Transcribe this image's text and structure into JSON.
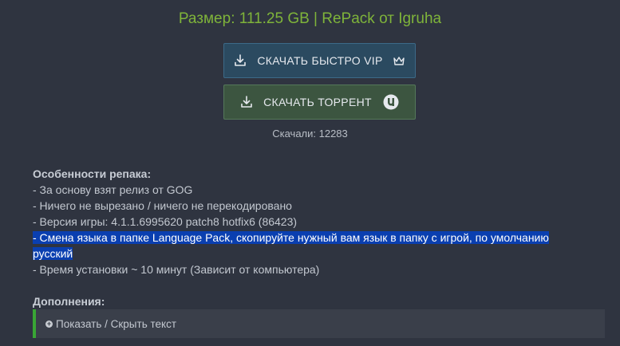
{
  "header": {
    "size_line": "Размер: 111.25 GB | RePack от Igruha"
  },
  "buttons": {
    "vip_label": "СКАЧАТЬ БЫСТРО VIP",
    "torrent_label": "СКАЧАТЬ ТОРРЕНТ"
  },
  "downloads": {
    "text": "Скачали: 12283"
  },
  "features": {
    "heading": "Особенности репака:",
    "items": [
      "- За основу взят релиз от GOG",
      "- Ничего не вырезано / ничего не перекодировано",
      "- Версия игры: 4.1.1.6995620 patch8 hotfix6 (86423)",
      "- Смена языка в папке Language Pack, скопируйте нужный вам язык в папку с игрой, по умолчанию русский",
      "- Время установки ~ 10 минут (Зависит от компьютера)"
    ]
  },
  "addons": {
    "heading": "Дополнения:",
    "spoiler_label": "Показать / Скрыть текст"
  },
  "colors": {
    "background": "#2f3440",
    "size_text": "#7fb43a",
    "vip_button": "#2b4a60",
    "torrent_button": "#3c5540",
    "selection_highlight": "#0a3fb0",
    "spoiler_accent": "#39a635"
  },
  "icons": {
    "download": "download-icon",
    "crown": "crown-icon",
    "utorrent": "utorrent-icon",
    "plus": "plus-circle-icon"
  }
}
